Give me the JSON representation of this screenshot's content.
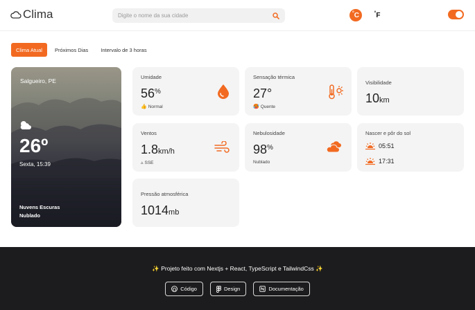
{
  "header": {
    "logo_text": "Clima",
    "search_placeholder": "Digite o nome da sua cidade",
    "unit_celsius": "C",
    "unit_fahrenheit": "F",
    "unit_degree": "°"
  },
  "tabs": [
    {
      "label": "Clima Atual",
      "active": true
    },
    {
      "label": "Próximos Dias",
      "active": false
    },
    {
      "label": "Intervalo de 3 horas",
      "active": false
    }
  ],
  "current": {
    "city": "Salgueiro, PE",
    "temperature": "26º",
    "datetime": "Sexta, 15:39",
    "description": "Nuvens Escuras",
    "condition": "Nublado"
  },
  "cards": {
    "humidity": {
      "title": "Umidade",
      "value": "56",
      "unit": "%",
      "note": "Normal",
      "note_icon": "thumbs-up-icon"
    },
    "feels_like": {
      "title": "Sensação térmica",
      "value": "27°",
      "note": "Quente",
      "note_icon": "hot-icon"
    },
    "visibility": {
      "title": "Visibilidade",
      "value": "10",
      "unit": "km"
    },
    "wind": {
      "title": "Ventos",
      "value": "1.8",
      "unit": "km/h",
      "note": "SSE",
      "note_icon": "direction-arrow-icon"
    },
    "cloudiness": {
      "title": "Nebulosidade",
      "value": "98",
      "unit": "%",
      "note": "Nublado"
    },
    "sun": {
      "title": "Nascer e pôr do sol",
      "sunrise": "05:51",
      "sunset": "17:31"
    },
    "pressure": {
      "title": "Pressão atmosférica",
      "value": "1014",
      "unit": "mb"
    }
  },
  "footer": {
    "tagline": "✨ Projeto feito com Nextjs + React, TypeScript e TailwindCss ✨",
    "buttons": [
      {
        "label": "Código",
        "icon": "github-icon"
      },
      {
        "label": "Design",
        "icon": "figma-icon"
      },
      {
        "label": "Documentação",
        "icon": "notion-icon"
      }
    ]
  },
  "colors": {
    "accent": "#f26a21",
    "card_bg": "#f4f4f4",
    "footer_bg": "#1c1c1e"
  }
}
